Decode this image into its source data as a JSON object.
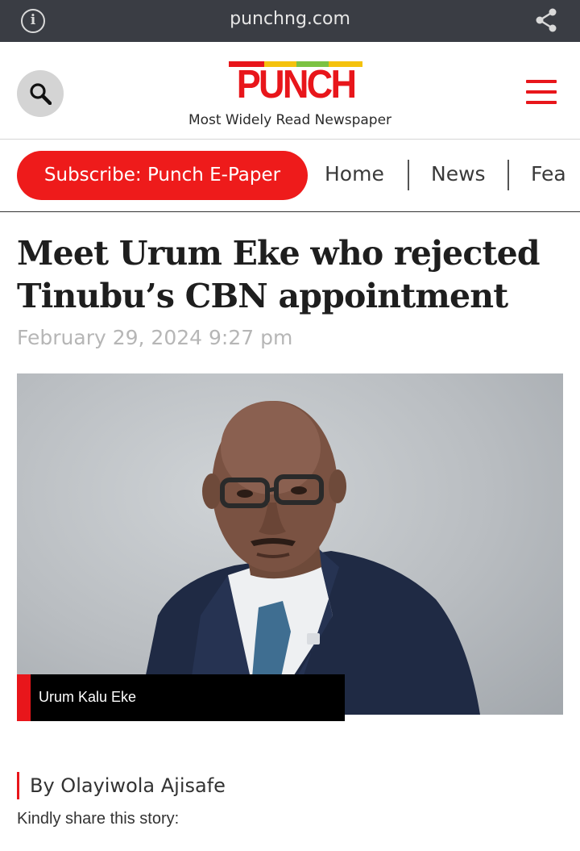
{
  "browser": {
    "url": "punchng.com",
    "info_icon": "info-icon",
    "share_icon": "share-icon"
  },
  "header": {
    "logo_text": "PUNCH",
    "tagline": "Most Widely Read Newspaper",
    "search_icon": "search-icon",
    "menu_icon": "hamburger-menu-icon",
    "brand_color": "#e8161b",
    "logo_stripe_colors": [
      "#e8161b",
      "#f4c20d",
      "#7cc242",
      "#f4c20d"
    ]
  },
  "nav": {
    "subscribe_label": "Subscribe: Punch E-Paper",
    "items": [
      {
        "label": "Home"
      },
      {
        "label": "News"
      },
      {
        "label": "Fea"
      }
    ]
  },
  "article": {
    "headline": "Meet Urum Eke who rejected Tinubu’s CBN appointment",
    "date": "February 29, 2024 9:27 pm",
    "image_caption": "Urum Kalu Eke",
    "byline": "By Olayiwola Ajisafe",
    "share_prompt": "Kindly share this story:"
  }
}
